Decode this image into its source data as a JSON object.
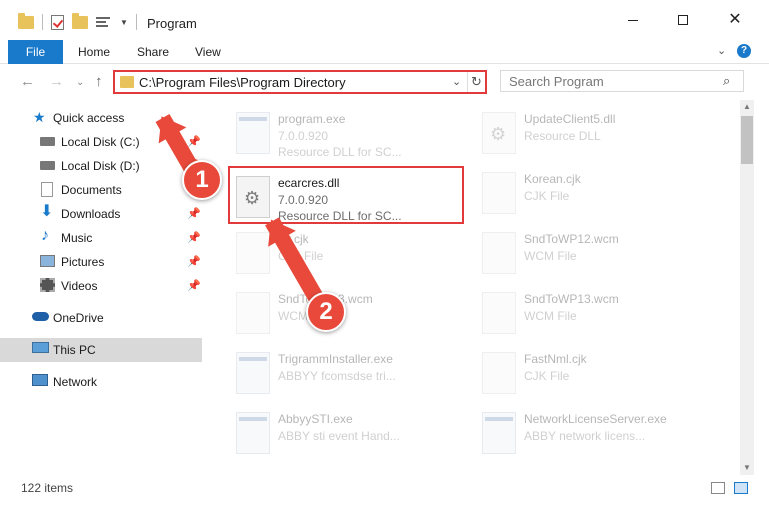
{
  "window": {
    "title": "Program"
  },
  "ribbon": {
    "file": "File",
    "tabs": [
      "Home",
      "Share",
      "View"
    ],
    "help": "?"
  },
  "address": {
    "path": "C:\\Program Files\\Program Directory",
    "dropdown": "⌄",
    "refresh": "↻"
  },
  "search": {
    "placeholder": "Search Program"
  },
  "nav": {
    "back": "←",
    "forward": "→",
    "recent": "⌄",
    "up": "↑",
    "items": [
      {
        "label": "Quick access",
        "icon": "star-icon",
        "pinned": false
      },
      {
        "label": "Local Disk (C:)",
        "icon": "drive-icon",
        "pinned": true
      },
      {
        "label": "Local Disk (D:)",
        "icon": "drive-icon",
        "pinned": true
      },
      {
        "label": "Documents",
        "icon": "documents-icon",
        "pinned": true
      },
      {
        "label": "Downloads",
        "icon": "download-icon",
        "pinned": true
      },
      {
        "label": "Music",
        "icon": "music-icon",
        "pinned": true
      },
      {
        "label": "Pictures",
        "icon": "pictures-icon",
        "pinned": true
      },
      {
        "label": "Videos",
        "icon": "videos-icon",
        "pinned": true
      },
      {
        "label": "OneDrive",
        "icon": "cloud-icon",
        "pinned": false
      },
      {
        "label": "This PC",
        "icon": "pc-icon",
        "pinned": false,
        "selected": true
      },
      {
        "label": "Network",
        "icon": "network-icon",
        "pinned": false
      }
    ]
  },
  "files": [
    {
      "name": "program.exe",
      "sub1": "7.0.0.920",
      "sub2": "Resource DLL for SC...",
      "type": "exe"
    },
    {
      "name": "UpdateClient5.dll",
      "sub1": "Resource DLL",
      "sub2": "",
      "type": "dll"
    },
    {
      "name": "ecarcres.dll",
      "sub1": "7.0.0.920",
      "sub2": "Resource DLL for SC...",
      "type": "dll",
      "highlight": true
    },
    {
      "name": "Korean.cjk",
      "sub1": "CJK File",
      "sub2": "",
      "type": "doc"
    },
    {
      "name": "Gr.cjk",
      "sub1": "CJK File",
      "sub2": "",
      "type": "doc"
    },
    {
      "name": "SndToWP12.wcm",
      "sub1": "WCM File",
      "sub2": "",
      "type": "doc"
    },
    {
      "name": "SndToWP13.wcm",
      "sub1": "WCM File",
      "sub2": "",
      "type": "doc"
    },
    {
      "name": "SndToWP13.wcm",
      "sub1": "WCM File",
      "sub2": "",
      "type": "doc"
    },
    {
      "name": "TrigrammInstaller.exe",
      "sub1": "ABBYY fcomsdse tri...",
      "sub2": "",
      "type": "exe"
    },
    {
      "name": "FastNml.cjk",
      "sub1": "CJK File",
      "sub2": "",
      "type": "doc"
    },
    {
      "name": "AbbyySTI.exe",
      "sub1": "ABBY sti event Hand...",
      "sub2": "",
      "type": "exe"
    },
    {
      "name": "NetworkLicenseServer.exe",
      "sub1": "ABBY network licens...",
      "sub2": "",
      "type": "exe"
    }
  ],
  "status": {
    "count": "122 items"
  },
  "callouts": {
    "one": "1",
    "two": "2"
  },
  "colors": {
    "accent": "#1979ca",
    "highlight": "#e23a3a",
    "callout": "#e8493b",
    "folder": "#e8c25a"
  }
}
